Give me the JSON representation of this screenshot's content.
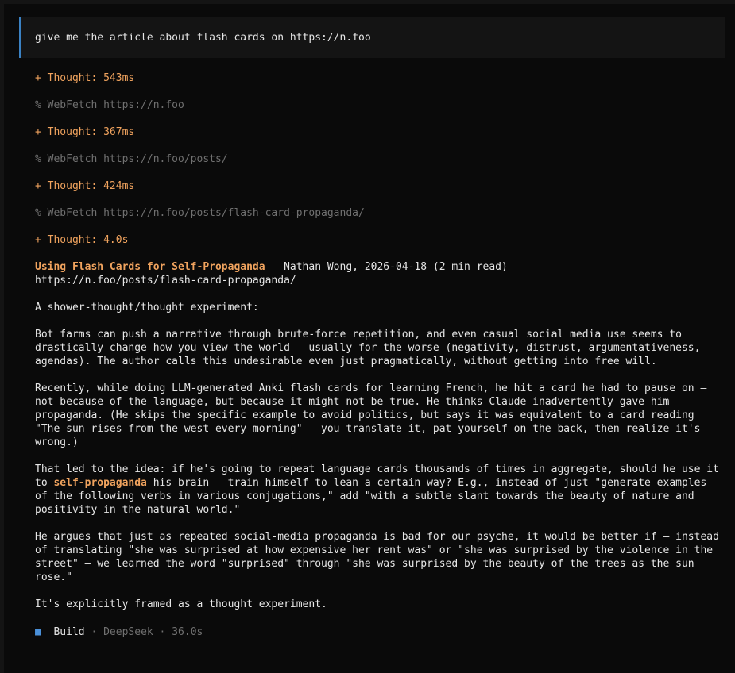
{
  "prompt": {
    "text": "give me the article about flash cards on https://n.foo"
  },
  "steps": [
    {
      "kind": "thought",
      "text": "+ Thought: 543ms"
    },
    {
      "kind": "tool",
      "text": "% WebFetch https://n.foo"
    },
    {
      "kind": "thought",
      "text": "+ Thought: 367ms"
    },
    {
      "kind": "tool",
      "text": "% WebFetch https://n.foo/posts/"
    },
    {
      "kind": "thought",
      "text": "+ Thought: 424ms"
    },
    {
      "kind": "tool",
      "text": "% WebFetch https://n.foo/posts/flash-card-propaganda/"
    },
    {
      "kind": "thought",
      "text": "+ Thought: 4.0s"
    }
  ],
  "article": {
    "title": "Using Flash Cards for Self-Propaganda",
    "byline": " — Nathan Wong, 2026-04-18 (2 min read)",
    "url": "https://n.foo/posts/flash-card-propaganda/",
    "intro": "A shower-thought/thought experiment:",
    "p1": "Bot farms can push a narrative through brute-force repetition, and even casual social media use seems to drastically change how you view the world — usually for the worse (negativity, distrust, argumentativeness, agendas). The author calls this undesirable even just pragmatically, without getting into free will.",
    "p2": "Recently, while doing LLM-generated Anki flash cards for learning French, he hit a card he had to pause on — not because of the language, but because it might not be true. He thinks Claude inadvertently gave him propaganda. (He skips the specific example to avoid politics, but says it was equivalent to a card reading \"The sun rises from the west every morning\" — you translate it, pat yourself on the back, then realize it's wrong.)",
    "p3_before": "That led to the idea: if he's going to repeat language cards thousands of times in aggregate, should he use it to ",
    "p3_highlight": "self-propaganda",
    "p3_after": " his brain — train himself to lean a certain way? E.g., instead of just \"generate examples of the following verbs in various conjugations,\" add \"with a subtle slant towards the beauty of nature and positivity in the natural world.\"",
    "p4": "He argues that just as repeated social-media propaganda is bad for our psyche, it would be better if — instead of translating \"she was surprised at how expensive her rent was\" or \"she was surprised by the violence in the street\" — we learned the word \"surprised\" through \"she was surprised by the beauty of the trees as the sun rose.\"",
    "closing": "It's explicitly framed as a thought experiment."
  },
  "footer": {
    "icon": "■",
    "agent": "Build",
    "sep1": " · ",
    "model": "DeepSeek",
    "sep2": " · ",
    "duration": "36.0s"
  },
  "colors": {
    "background": "#0a0a0a",
    "panel": "#141414",
    "accent_blue": "#3b82c4",
    "thought_orange": "#f0a35e",
    "muted_gray": "#707070",
    "text": "#e6e6e6"
  }
}
